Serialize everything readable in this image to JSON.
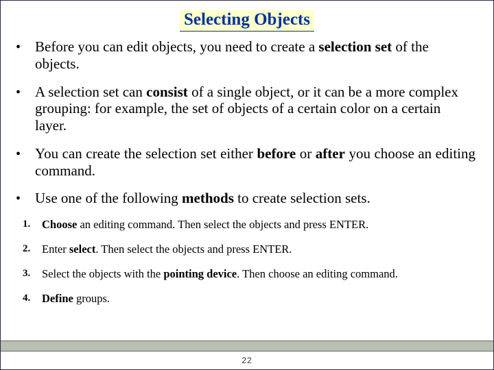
{
  "title": "Selecting Objects",
  "bullets": {
    "b1_a": "Before you can edit objects, you need to create a ",
    "b1_bold": "selection set",
    "b1_b": " of the objects.",
    "b2_a": "A selection set can ",
    "b2_bold": "consist",
    "b2_b": " of a single object, or it can be a more complex grouping: for example, the set of objects of a certain color on a certain layer.",
    "b3_a": "You can create the selection set either ",
    "b3_bold1": "before",
    "b3_mid": " or ",
    "b3_bold2": "after",
    "b3_b": " you choose an editing command.",
    "b4_a": "Use one of the following ",
    "b4_bold": "methods",
    "b4_b": " to create selection sets."
  },
  "methods": {
    "m1_bold": "Choose",
    "m1_rest": " an editing command. Then select the objects and press ENTER.",
    "m2_a": "Enter ",
    "m2_bold": "select",
    "m2_b": ". Then select the objects and press ENTER.",
    "m3_a": "Select the objects with the ",
    "m3_bold": "pointing device",
    "m3_b": ". Then choose an editing command.",
    "m4_bold": "Define",
    "m4_rest": " groups."
  },
  "page_number": "22"
}
